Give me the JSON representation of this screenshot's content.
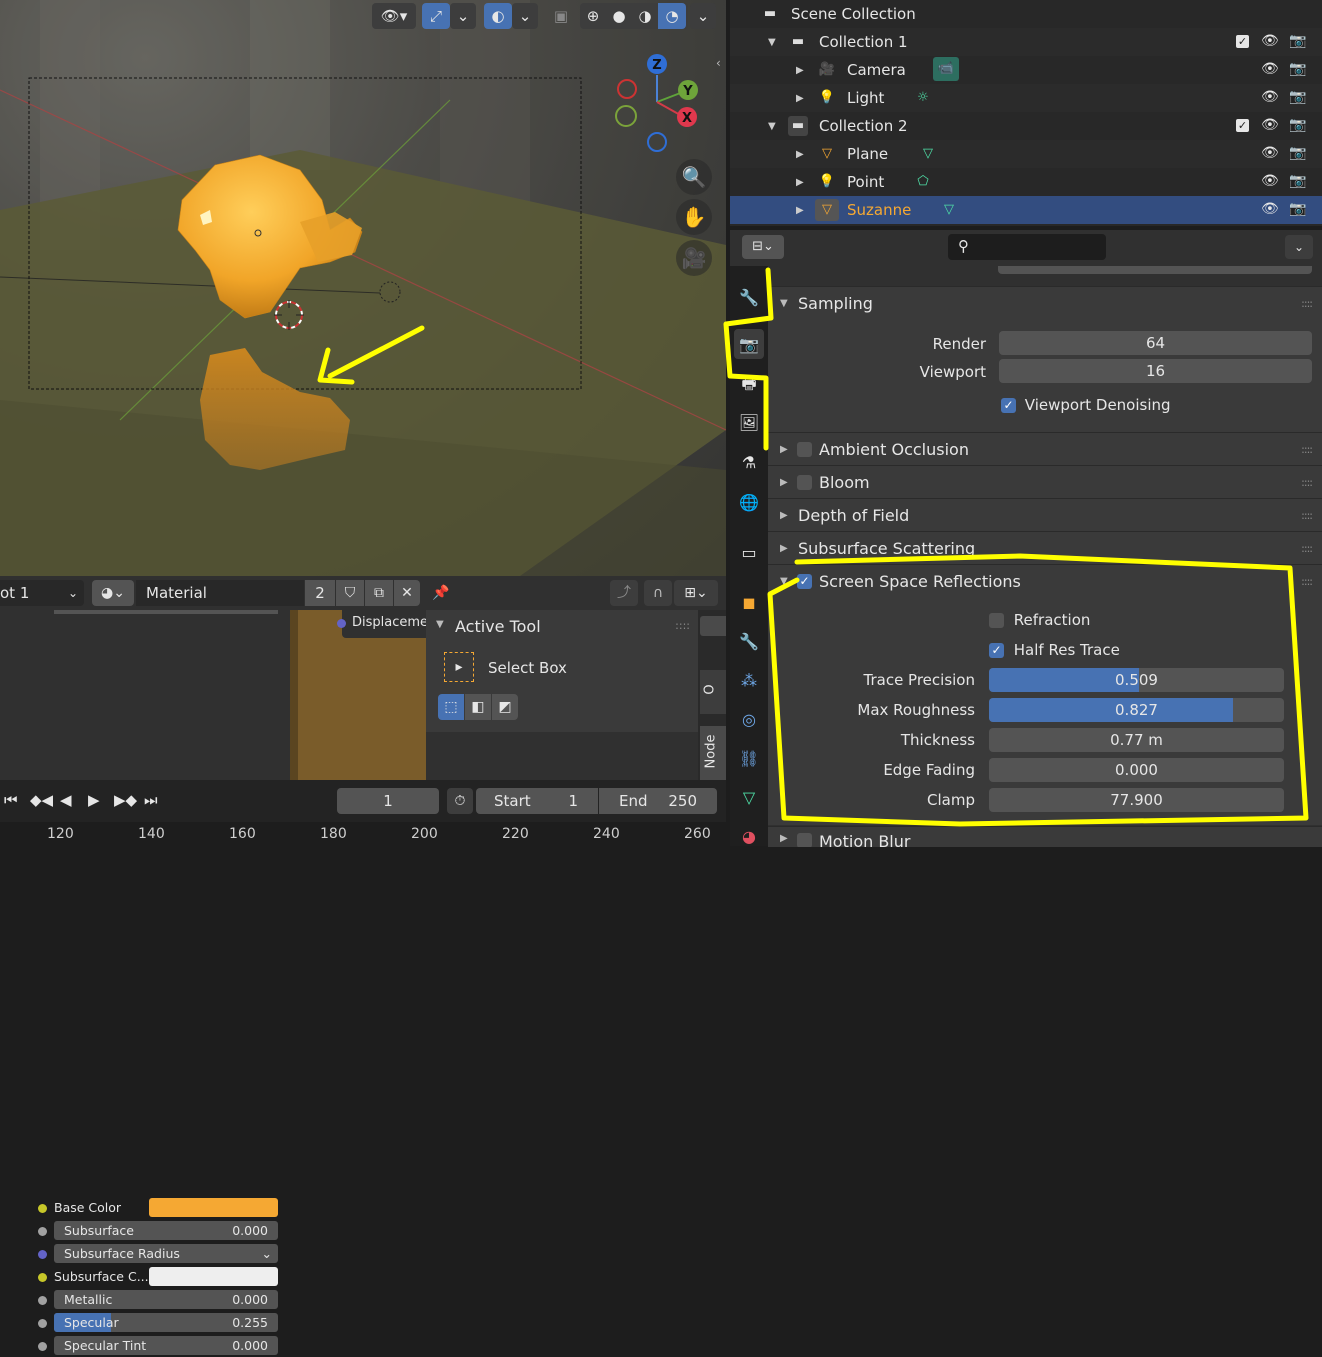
{
  "outliner": {
    "scene_collection": "Scene Collection",
    "items": [
      {
        "label": "Collection 1"
      },
      {
        "label": "Camera"
      },
      {
        "label": "Light"
      },
      {
        "label": "Collection 2"
      },
      {
        "label": "Plane"
      },
      {
        "label": "Point"
      },
      {
        "label": "Suzanne"
      }
    ]
  },
  "properties": {
    "sampling": {
      "title": "Sampling",
      "render_label": "Render",
      "render_value": "64",
      "viewport_label": "Viewport",
      "viewport_value": "16",
      "denoise_label": "Viewport Denoising"
    },
    "panels": [
      "Ambient Occlusion",
      "Bloom",
      "Depth of Field",
      "Subsurface Scattering"
    ],
    "ssr": {
      "title": "Screen Space Reflections",
      "refraction_label": "Refraction",
      "half_res_label": "Half Res Trace",
      "rows": [
        {
          "label": "Trace Precision",
          "value": "0.509",
          "fraction": 0.509
        },
        {
          "label": "Max Roughness",
          "value": "0.827",
          "fraction": 0.827
        },
        {
          "label": "Thickness",
          "value": "0.77 m",
          "fraction": 0
        },
        {
          "label": "Edge Fading",
          "value": "0.000",
          "fraction": 0
        },
        {
          "label": "Clamp",
          "value": "77.900",
          "fraction": 0
        }
      ]
    },
    "motion_blur": "Motion Blur"
  },
  "node_editor": {
    "slot_label": "ot 1",
    "material_name": "Material",
    "user_count": "2",
    "rows": [
      {
        "label": "Base Color",
        "type": "color",
        "color": "#f5a833"
      },
      {
        "label": "Subsurface",
        "value": "0.000"
      },
      {
        "label": "Subsurface Radius",
        "type": "dropdown"
      },
      {
        "label": "Subsurface C...",
        "type": "color",
        "color": "#eeeeee"
      },
      {
        "label": "Metallic",
        "value": "0.000"
      },
      {
        "label": "Specular",
        "value": "0.255",
        "fraction": 0.255
      },
      {
        "label": "Specular Tint",
        "value": "0.000"
      }
    ],
    "displacement_label": "Displacemen",
    "active_tool_title": "Active Tool",
    "select_box_label": "Select Box",
    "side_tabs": [
      "Node",
      "O"
    ]
  },
  "timeline": {
    "current_frame": "1",
    "start_label": "Start",
    "start_value": "1",
    "end_label": "End",
    "end_value": "250",
    "ruler": [
      "120",
      "140",
      "160",
      "180",
      "200",
      "220",
      "240",
      "260"
    ]
  },
  "colors": {
    "accent": "#4772b3",
    "highlight_yellow": "#ffff00",
    "selected_orange": "#f5a833"
  }
}
